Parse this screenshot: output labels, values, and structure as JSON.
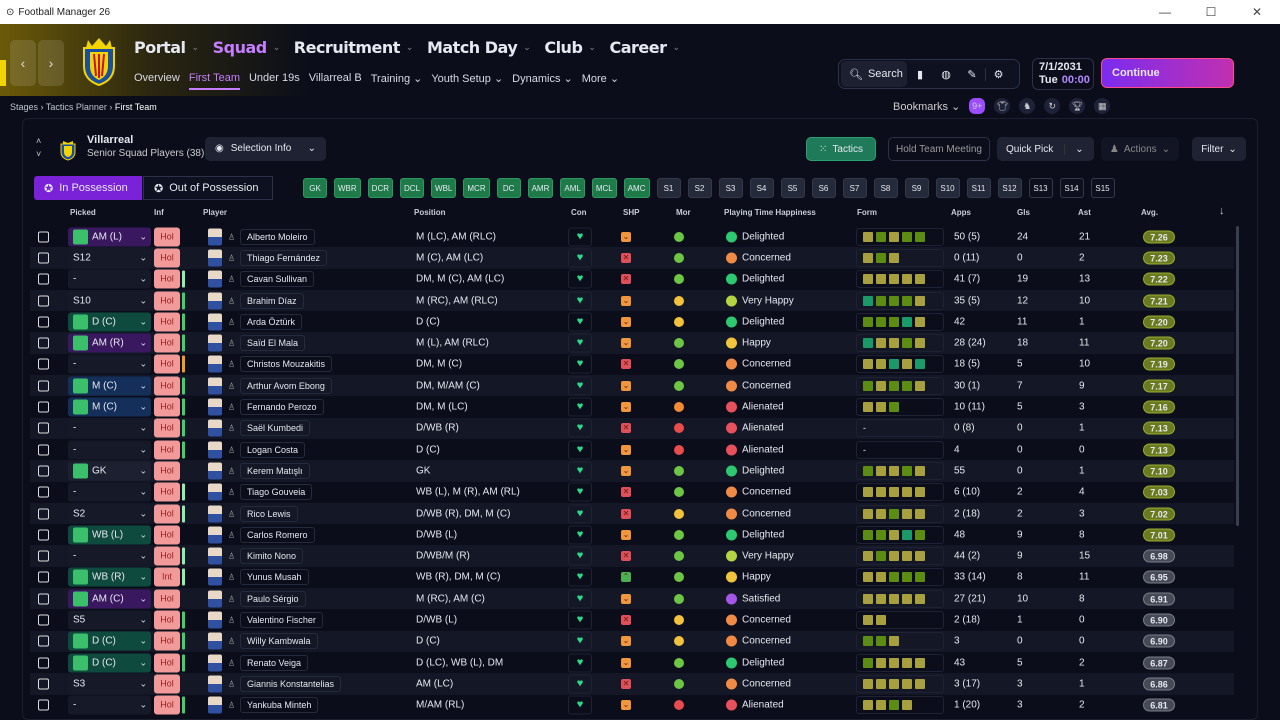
{
  "window": {
    "title": "Football Manager 26",
    "controls": [
      "—",
      "☐",
      "✕"
    ]
  },
  "nav": {
    "main": [
      {
        "label": "Portal"
      },
      {
        "label": "Squad",
        "active": true
      },
      {
        "label": "Recruitment"
      },
      {
        "label": "Match Day"
      },
      {
        "label": "Club"
      },
      {
        "label": "Career"
      }
    ],
    "sub": [
      {
        "label": "Overview"
      },
      {
        "label": "First Team",
        "active": true
      },
      {
        "label": "Under 19s"
      },
      {
        "label": "Villarreal B"
      },
      {
        "label": "Training ⌄"
      },
      {
        "label": "Youth Setup ⌄"
      },
      {
        "label": "Dynamics ⌄"
      },
      {
        "label": "More ⌄"
      }
    ],
    "back": "‹",
    "forward": "›"
  },
  "toolbar": {
    "search": "Search",
    "date": "7/1/2031",
    "day": "Tue",
    "time": "00:00",
    "continue": "Continue",
    "bookmarks": "Bookmarks",
    "badge": "9+"
  },
  "breadcrumb": [
    "Stages",
    "Tactics Planner",
    "First Team"
  ],
  "team": {
    "name": "Villarreal",
    "subtitle": "Senior Squad Players (38)",
    "selection_info": "Selection Info"
  },
  "actions": {
    "tactics": "Tactics",
    "meeting": "Hold Team Meeting",
    "quick_pick": "Quick Pick",
    "actions": "Actions",
    "filter": "Filter"
  },
  "possession": {
    "in": "In Possession",
    "out": "Out of Possession"
  },
  "slots": [
    "GK",
    "WBR",
    "DCR",
    "DCL",
    "WBL",
    "MCR",
    "DC",
    "AMR",
    "AML",
    "MCL",
    "AMC"
  ],
  "subs": [
    "S1",
    "S2",
    "S3",
    "S4",
    "S5",
    "S6",
    "S7",
    "S8",
    "S9",
    "S10",
    "S11",
    "S12",
    "S13",
    "S14",
    "S15"
  ],
  "columns": {
    "picked": "Picked",
    "inf": "Inf",
    "player": "Player",
    "position": "Position",
    "con": "Con",
    "shp": "SHP",
    "mor": "Mor",
    "pth": "Playing Time Happiness",
    "form": "Form",
    "apps": "Apps",
    "gls": "Gls",
    "ast": "Ast",
    "avg": "Avg.",
    "sort": "↓"
  },
  "colors": {
    "accent": "#c77dff",
    "green_slot": "#1f7a4a",
    "form_y": "#a89f3e",
    "form_g": "#5d8c12",
    "form_t": "#1a9a68"
  },
  "players": [
    {
      "pick": "AM (L)",
      "pc": "am",
      "inf": "Hol",
      "bar": "",
      "name": "Alberto Moleiro",
      "pos": "M (LC), AM (RLC)",
      "shp": "o",
      "mor": "g",
      "pth": "Delighted",
      "form": "ygygg",
      "apps": "50 (5)",
      "gls": "24",
      "ast": "21",
      "avg": "7.26"
    },
    {
      "pick": "S12",
      "pc": "",
      "inf": "Hol",
      "bar": "",
      "name": "Thiago Fernández",
      "pos": "M (C), AM (LC)",
      "shp": "r",
      "mor": "g",
      "pth": "Concerned",
      "form": "ygy",
      "apps": "0 (11)",
      "gls": "0",
      "ast": "2",
      "avg": "7.23"
    },
    {
      "pick": "-",
      "pc": "",
      "inf": "Hol",
      "bar": "lg",
      "name": "Cavan Sullivan",
      "pos": "DM, M (C), AM (LC)",
      "shp": "r",
      "mor": "g",
      "pth": "Delighted",
      "form": "yyyyy",
      "apps": "41 (7)",
      "gls": "19",
      "ast": "13",
      "avg": "7.22"
    },
    {
      "pick": "S10",
      "pc": "",
      "inf": "Hol",
      "bar": "g",
      "name": "Brahim Díaz",
      "pos": "M (RC), AM (RLC)",
      "shp": "o",
      "mor": "y",
      "pth": "Very Happy",
      "form": "tgggy",
      "apps": "35 (5)",
      "gls": "12",
      "ast": "10",
      "avg": "7.21"
    },
    {
      "pick": "D (C)",
      "pc": "d",
      "inf": "Hol",
      "bar": "g",
      "name": "Arda Öztürk",
      "pos": "D (C)",
      "shp": "o",
      "mor": "y",
      "pth": "Delighted",
      "form": "gggty",
      "apps": "42",
      "gls": "11",
      "ast": "1",
      "avg": "7.20"
    },
    {
      "pick": "AM (R)",
      "pc": "am",
      "inf": "Hol",
      "bar": "g",
      "name": "Saïd El Mala",
      "pos": "M (L), AM (RLC)",
      "shp": "o",
      "mor": "g",
      "pth": "Happy",
      "form": "tyygy",
      "apps": "28 (24)",
      "gls": "18",
      "ast": "11",
      "avg": "7.20"
    },
    {
      "pick": "-",
      "pc": "",
      "inf": "Hol",
      "bar": "o",
      "name": "Christos Mouzakitis",
      "pos": "DM, M (C)",
      "shp": "r",
      "mor": "g",
      "pth": "Concerned",
      "form": "yytyt",
      "apps": "18 (5)",
      "gls": "5",
      "ast": "10",
      "avg": "7.19"
    },
    {
      "pick": "M (C)",
      "pc": "m",
      "inf": "Hol",
      "bar": "g",
      "name": "Arthur Avom Ebong",
      "pos": "DM, M/AM (C)",
      "shp": "o",
      "mor": "g",
      "pth": "Concerned",
      "form": "gyggy",
      "apps": "30 (1)",
      "gls": "7",
      "ast": "9",
      "avg": "7.17"
    },
    {
      "pick": "M (C)",
      "pc": "m",
      "inf": "Hol",
      "bar": "g",
      "name": "Fernando Perozo",
      "pos": "DM, M (LC)",
      "shp": "o",
      "mor": "o",
      "pth": "Alienated",
      "form": "yyg",
      "apps": "10 (11)",
      "gls": "5",
      "ast": "3",
      "avg": "7.16"
    },
    {
      "pick": "-",
      "pc": "",
      "inf": "Hol",
      "bar": "g",
      "name": "Saël Kumbedi",
      "pos": "D/WB (R)",
      "shp": "r",
      "mor": "r",
      "pth": "Alienated",
      "form": "-",
      "apps": "0 (8)",
      "gls": "0",
      "ast": "1",
      "avg": "7.13"
    },
    {
      "pick": "-",
      "pc": "",
      "inf": "Hol",
      "bar": "g",
      "name": "Logan Costa",
      "pos": "D (C)",
      "shp": "o",
      "mor": "r",
      "pth": "Alienated",
      "form": "-",
      "apps": "4",
      "gls": "0",
      "ast": "0",
      "avg": "7.13"
    },
    {
      "pick": "GK",
      "pc": "gk",
      "inf": "Hol",
      "bar": "",
      "name": "Kerem Matışlı",
      "pos": "GK",
      "shp": "o",
      "mor": "g",
      "pth": "Delighted",
      "form": "gyygy",
      "apps": "55",
      "gls": "0",
      "ast": "1",
      "avg": "7.10"
    },
    {
      "pick": "-",
      "pc": "",
      "inf": "Hol",
      "bar": "lg",
      "name": "Tiago Gouveia",
      "pos": "WB (L), M (R), AM (RL)",
      "shp": "r",
      "mor": "g",
      "pth": "Concerned",
      "form": "yyyyy",
      "apps": "6 (10)",
      "gls": "2",
      "ast": "4",
      "avg": "7.03"
    },
    {
      "pick": "S2",
      "pc": "",
      "inf": "Hol",
      "bar": "lg",
      "name": "Rico Lewis",
      "pos": "D/WB (R), DM, M (C)",
      "shp": "r",
      "mor": "y",
      "pth": "Concerned",
      "form": "yygyy",
      "apps": "2 (18)",
      "gls": "2",
      "ast": "3",
      "avg": "7.02"
    },
    {
      "pick": "WB (L)",
      "pc": "d",
      "inf": "Hol",
      "bar": "",
      "name": "Carlos Romero",
      "pos": "D/WB (L)",
      "shp": "o",
      "mor": "g",
      "pth": "Delighted",
      "form": "ggytg",
      "apps": "48",
      "gls": "9",
      "ast": "8",
      "avg": "7.01"
    },
    {
      "pick": "-",
      "pc": "",
      "inf": "Hol",
      "bar": "lg",
      "name": "Kimito Nono",
      "pos": "D/WB/M (R)",
      "shp": "r",
      "mor": "g",
      "pth": "Very Happy",
      "form": "ygyyy",
      "apps": "44 (2)",
      "gls": "9",
      "ast": "15",
      "avg": "6.98"
    },
    {
      "pick": "WB (R)",
      "pc": "d",
      "inf": "Int",
      "bar": "lg",
      "name": "Yunus Musah",
      "pos": "WB (R), DM, M (C)",
      "shp": "gr",
      "mor": "g",
      "pth": "Happy",
      "form": "yyggg",
      "apps": "33 (14)",
      "gls": "8",
      "ast": "11",
      "avg": "6.95"
    },
    {
      "pick": "AM (C)",
      "pc": "am",
      "inf": "Hol",
      "bar": "",
      "name": "Paulo Sérgio",
      "pos": "M (RC), AM (C)",
      "shp": "o",
      "mor": "g",
      "pth": "Satisfied",
      "form": "yyyyy",
      "apps": "27 (21)",
      "gls": "10",
      "ast": "8",
      "avg": "6.91"
    },
    {
      "pick": "S5",
      "pc": "",
      "inf": "Hol",
      "bar": "g",
      "name": "Valentino Fischer",
      "pos": "D/WB (L)",
      "shp": "r",
      "mor": "y",
      "pth": "Concerned",
      "form": "yy",
      "apps": "2 (18)",
      "gls": "1",
      "ast": "0",
      "avg": "6.90"
    },
    {
      "pick": "D (C)",
      "pc": "d",
      "inf": "Hol",
      "bar": "g",
      "name": "Willy Kambwala",
      "pos": "D (C)",
      "shp": "o",
      "mor": "y",
      "pth": "Concerned",
      "form": "ggy",
      "apps": "3",
      "gls": "0",
      "ast": "0",
      "avg": "6.90"
    },
    {
      "pick": "D (C)",
      "pc": "d",
      "inf": "Hol",
      "bar": "g",
      "name": "Renato Veiga",
      "pos": "D (LC), WB (L), DM",
      "shp": "o",
      "mor": "g",
      "pth": "Delighted",
      "form": "gyyyy",
      "apps": "43",
      "gls": "5",
      "ast": "2",
      "avg": "6.87"
    },
    {
      "pick": "S3",
      "pc": "",
      "inf": "Hol",
      "bar": "",
      "name": "Giannis Konstantelias",
      "pos": "AM (LC)",
      "shp": "r",
      "mor": "g",
      "pth": "Concerned",
      "form": "yyyyy",
      "apps": "3 (17)",
      "gls": "3",
      "ast": "1",
      "avg": "6.86"
    },
    {
      "pick": "-",
      "pc": "",
      "inf": "Hol",
      "bar": "g",
      "name": "Yankuba Minteh",
      "pos": "M/AM (RL)",
      "shp": "o",
      "mor": "r",
      "pth": "Alienated",
      "form": "yygy",
      "apps": "1 (20)",
      "gls": "3",
      "ast": "2",
      "avg": "6.81"
    }
  ]
}
